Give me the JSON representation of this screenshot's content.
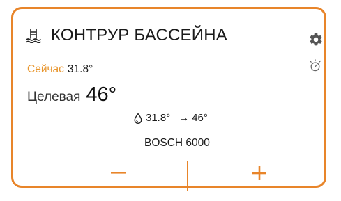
{
  "card": {
    "title": "КОНТРУР БАССЕЙНА",
    "accent_color": "#E8852A",
    "icons": {
      "title_icon": "pool-icon",
      "settings_icon": "gear-icon",
      "status_icon": "thermostat-icon",
      "water_icon": "water-drop-icon"
    },
    "current": {
      "label": "Сейчас",
      "value": "31.8°"
    },
    "target": {
      "label": "Целевая",
      "value": "46°"
    },
    "info": {
      "from": "31.8°",
      "arrow": "→",
      "to": "46°"
    },
    "model": "BOSCH 6000",
    "controls": {
      "decrease": "−",
      "increase": "+"
    }
  }
}
